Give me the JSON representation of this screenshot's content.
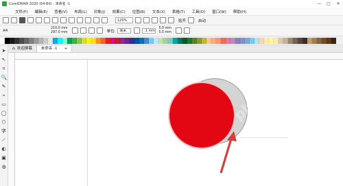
{
  "titlebar": {
    "title": "CorelDRAW 2020 (64-Bit) - 未命名 -1",
    "min": "—",
    "max": "□",
    "close": "✕"
  },
  "menu": [
    "文件(F)",
    "编辑(E)",
    "查看(V)",
    "布局(L)",
    "对象(J)",
    "效果(C)",
    "位图(B)",
    "文本(X)",
    "表格(T)",
    "工具(O)",
    "窗口(W)",
    "帮助(H)"
  ],
  "toolbar1": {
    "zoom": "120%",
    "snap_label": "贴齐",
    "launch_label": "启动"
  },
  "toolbar2": {
    "preset": "A4",
    "width": "210.0 mm",
    "height": "297.0 mm",
    "units_label": "单位:",
    "units_value": "毫米",
    "nudge": ".1 mm",
    "dup_x": "5.0 mm",
    "dup_y": "5.0 mm"
  },
  "tabs": {
    "welcome": "欢迎屏幕",
    "document": "未命名 -1",
    "add": "+"
  },
  "palette_colors": [
    "#ffffff",
    "#000000",
    "#1a1a1a",
    "#333333",
    "#4d4d4d",
    "#666666",
    "#808080",
    "#999999",
    "#b3b3b3",
    "#cccccc",
    "#e6e6e6",
    "#00aeef",
    "#00ffff",
    "#7fffd4",
    "#00a651",
    "#39b54a",
    "#8dc63f",
    "#d7df23",
    "#fff200",
    "#ffde17",
    "#f7941d",
    "#f26522",
    "#ed1c24",
    "#ec008c",
    "#be1e2d",
    "#92278f",
    "#662d91",
    "#2e3192",
    "#0054a6",
    "#0072bc",
    "#448ccb",
    "#6dcff6",
    "#bfe6f9",
    "#c2e0b4",
    "#a3d39c",
    "#7accc8",
    "#00a99d",
    "#00746b",
    "#005e20",
    "#197b30",
    "#598527",
    "#8a9a2b",
    "#c4b72e",
    "#fdc689",
    "#f9ad81",
    "#f7977a",
    "#f26c4f",
    "#f06eaa",
    "#bd8cbf",
    "#8781bd",
    "#8393ca",
    "#7da7d9",
    "#6ecff6",
    "#b6e1f3",
    "#fbd4b4",
    "#ffeba3",
    "#fff799",
    "#f6eeb1",
    "#e1c6a8",
    "#c7b299",
    "#998675",
    "#736357",
    "#534741",
    "#362f2d",
    "#c69c6d",
    "#a67c52",
    "#8c6239",
    "#754c24",
    "#603913",
    "#3c2415"
  ],
  "tools": [
    "➤",
    "↖",
    "⌗",
    "🔍",
    "✎",
    "⌁",
    "▭",
    "◯",
    "⬡",
    "字",
    "⟋",
    "◐",
    "▣",
    "◍"
  ]
}
